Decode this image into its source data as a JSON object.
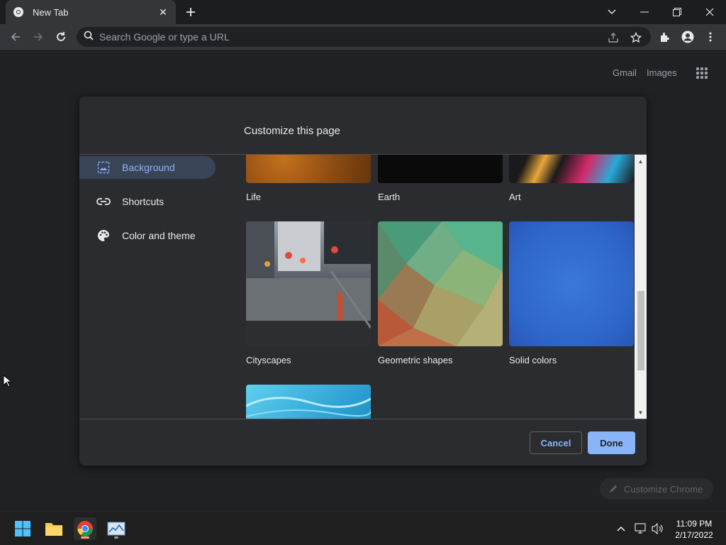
{
  "tab": {
    "title": "New Tab",
    "close_icon": "close-icon"
  },
  "omnibox": {
    "placeholder": "Search Google or type a URL"
  },
  "header_links": {
    "gmail": "Gmail",
    "images": "Images"
  },
  "dialog": {
    "title": "Customize this page",
    "sidebar": [
      {
        "label": "Background",
        "icon": "image-icon",
        "active": true
      },
      {
        "label": "Shortcuts",
        "icon": "link-icon",
        "active": false
      },
      {
        "label": "Color and theme",
        "icon": "palette-icon",
        "active": false
      }
    ],
    "collections": [
      {
        "label": "Life"
      },
      {
        "label": "Earth"
      },
      {
        "label": "Art"
      },
      {
        "label": "Cityscapes"
      },
      {
        "label": "Geometric shapes"
      },
      {
        "label": "Solid colors"
      },
      {
        "label": ""
      }
    ],
    "cancel_label": "Cancel",
    "done_label": "Done"
  },
  "customize_chrome": "Customize Chrome",
  "taskbar": {
    "time": "11:09 PM",
    "date": "2/17/2022"
  },
  "colors": {
    "accent": "#8ab4f8",
    "background": "#202124",
    "dialog": "#2b2c2f"
  }
}
